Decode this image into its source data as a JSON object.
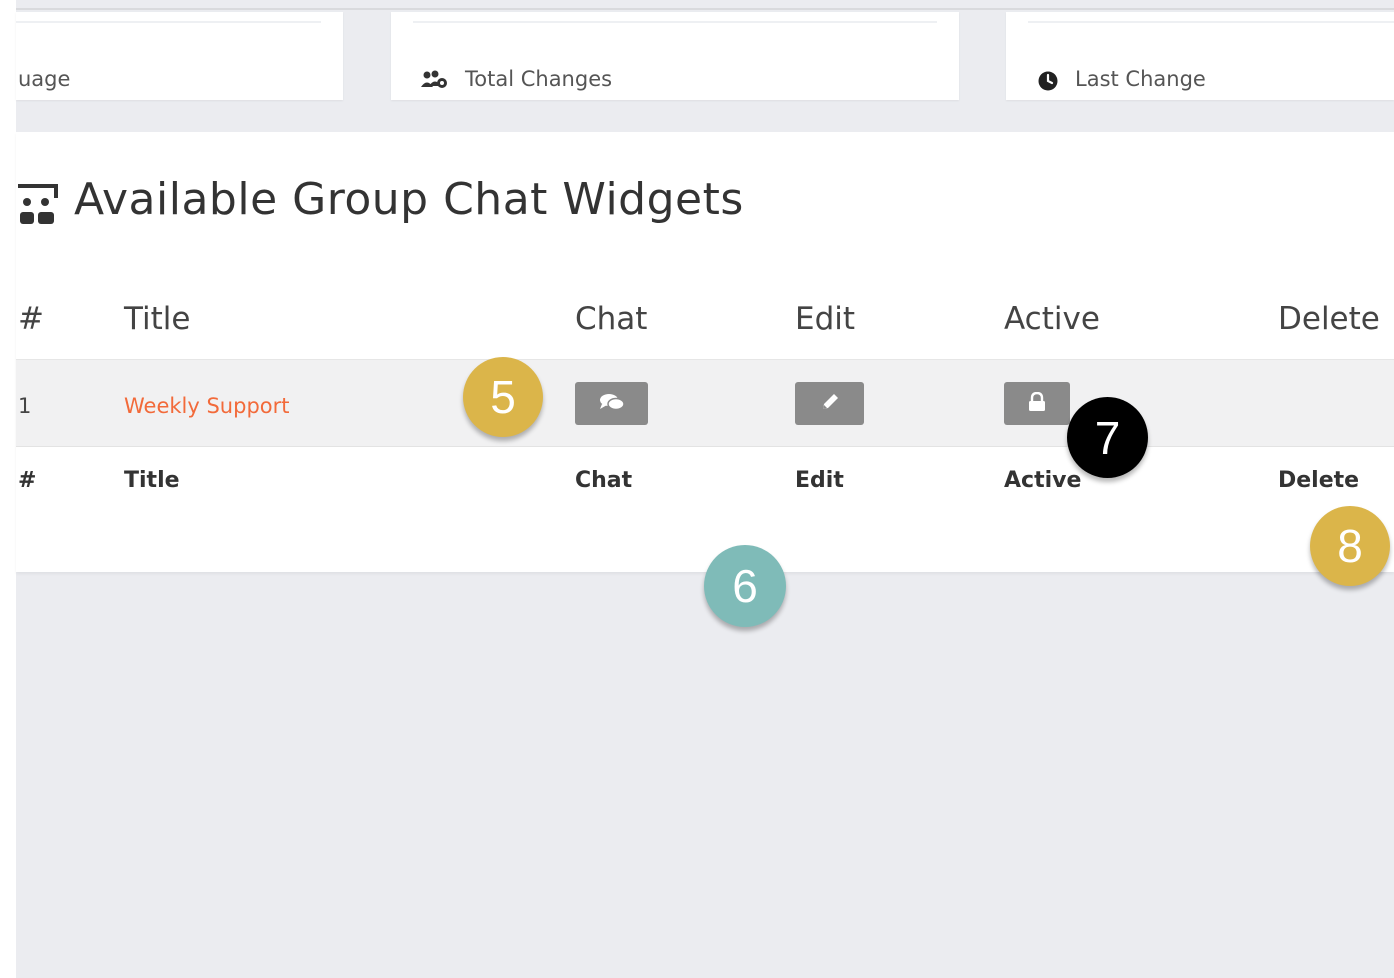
{
  "stats": {
    "usage_label": "uage",
    "total_changes_label": "Total Changes",
    "last_change_label": "Last Change"
  },
  "panel": {
    "title": "Available Group Chat Widgets",
    "columns": [
      "#",
      "Title",
      "Chat",
      "Edit",
      "Active",
      "Delete"
    ],
    "rows": [
      {
        "num": "1",
        "title": "Weekly Support"
      }
    ],
    "footer": [
      "#",
      "Title",
      "Chat",
      "Edit",
      "Active",
      "Delete"
    ]
  },
  "icons": {
    "title": "group-chat-icon",
    "total_changes": "users-cog-icon",
    "last_change": "clock-icon",
    "chat": "comments-icon",
    "edit": "pencil-icon",
    "active": "lock-icon"
  },
  "markers": [
    {
      "label": "5",
      "color": "#dbb54a"
    },
    {
      "label": "6",
      "color": "#7fbbb8"
    },
    {
      "label": "7",
      "color": "#000000"
    },
    {
      "label": "8",
      "color": "#dbb54a"
    }
  ],
  "colors": {
    "link": "#f26a3a",
    "button": "#8a8a8a",
    "background": "#ebecf0"
  }
}
